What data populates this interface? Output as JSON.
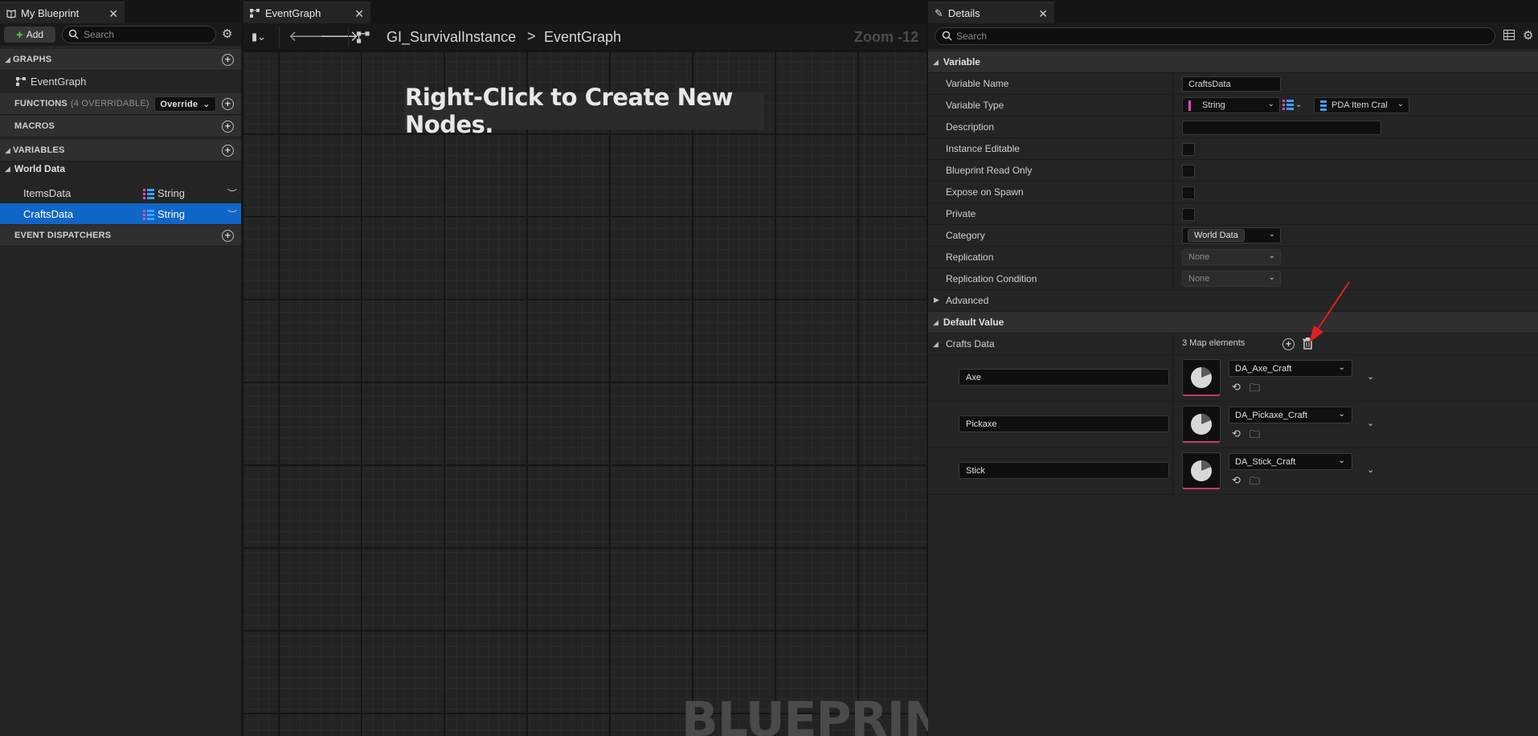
{
  "left_panel": {
    "tab_title": "My Blueprint",
    "add_label": "Add",
    "search_placeholder": "Search",
    "sections": {
      "graphs": "GRAPHS",
      "functions": "FUNCTIONS",
      "functions_count": "(4 OVERRIDABLE)",
      "override_label": "Override",
      "macros": "MACROS",
      "variables": "VARIABLES",
      "event_dispatchers": "EVENT DISPATCHERS"
    },
    "graph_item": "EventGraph",
    "variable_category": "World Data",
    "variables": [
      {
        "name": "ItemsData",
        "type": "String"
      },
      {
        "name": "CraftsData",
        "type": "String"
      }
    ]
  },
  "center_panel": {
    "tab_title": "EventGraph",
    "breadcrumb_root": "GI_SurvivalInstance",
    "breadcrumb_separator": ">",
    "breadcrumb_leaf": "EventGraph",
    "zoom": "Zoom -12",
    "hint": "Right-Click to Create New Nodes.",
    "watermark": "BLUEPRINT"
  },
  "details_panel": {
    "tab_title": "Details",
    "search_placeholder": "Search",
    "variable_section": "Variable",
    "props": {
      "variable_name_label": "Variable Name",
      "variable_name_value": "CraftsData",
      "variable_type_label": "Variable Type",
      "variable_type_value": "String",
      "value_type": "PDA Item Cral",
      "description_label": "Description",
      "instance_editable_label": "Instance Editable",
      "read_only_label": "Blueprint Read Only",
      "expose_label": "Expose on Spawn",
      "private_label": "Private",
      "category_label": "Category",
      "category_value": "World Data",
      "replication_label": "Replication",
      "replication_value": "None",
      "replication_condition_label": "Replication Condition",
      "replication_condition_value": "None"
    },
    "advanced_section": "Advanced",
    "default_value_section": "Default Value",
    "map": {
      "label": "Crafts Data",
      "count": "3 Map elements",
      "elements": [
        {
          "key": "Axe",
          "asset": "DA_Axe_Craft"
        },
        {
          "key": "Pickaxe",
          "asset": "DA_Pickaxe_Craft"
        },
        {
          "key": "Stick",
          "asset": "DA_Stick_Craft"
        }
      ]
    },
    "colors": {
      "selection": "#1066c6",
      "key_pin": "#e545c9",
      "value_pin": "#3ba2ff",
      "annotation_arrow": "#e02020"
    }
  }
}
